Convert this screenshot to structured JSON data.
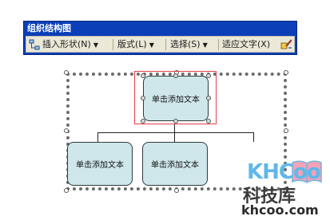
{
  "toolbar": {
    "title": "组织结构图",
    "insert_shape": "插入形状(N)",
    "layout": "版式(L)",
    "select": "选择(S)",
    "fit_text": "适应文字(X)"
  },
  "diagram": {
    "top_node": "单击添加文本",
    "left_node": "单击添加文本",
    "right_node": "单击添加文本"
  },
  "watermark": {
    "logo": "KHCoo",
    "name_cn": "科技库",
    "url": "khcoo.com"
  },
  "colors": {
    "toolbar_title": "#0a3fb8",
    "node_fill": "#cfe7ea",
    "selection": "#e0404a"
  }
}
